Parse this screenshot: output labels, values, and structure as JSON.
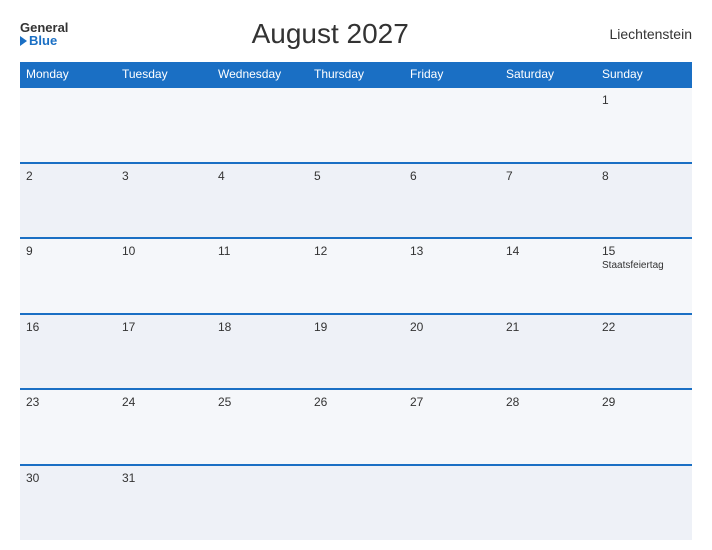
{
  "header": {
    "logo_general": "General",
    "logo_blue": "Blue",
    "title": "August 2027",
    "country": "Liechtenstein"
  },
  "weekdays": [
    "Monday",
    "Tuesday",
    "Wednesday",
    "Thursday",
    "Friday",
    "Saturday",
    "Sunday"
  ],
  "weeks": [
    [
      {
        "day": "",
        "event": ""
      },
      {
        "day": "",
        "event": ""
      },
      {
        "day": "",
        "event": ""
      },
      {
        "day": "",
        "event": ""
      },
      {
        "day": "",
        "event": ""
      },
      {
        "day": "",
        "event": ""
      },
      {
        "day": "1",
        "event": ""
      }
    ],
    [
      {
        "day": "2",
        "event": ""
      },
      {
        "day": "3",
        "event": ""
      },
      {
        "day": "4",
        "event": ""
      },
      {
        "day": "5",
        "event": ""
      },
      {
        "day": "6",
        "event": ""
      },
      {
        "day": "7",
        "event": ""
      },
      {
        "day": "8",
        "event": ""
      }
    ],
    [
      {
        "day": "9",
        "event": ""
      },
      {
        "day": "10",
        "event": ""
      },
      {
        "day": "11",
        "event": ""
      },
      {
        "day": "12",
        "event": ""
      },
      {
        "day": "13",
        "event": ""
      },
      {
        "day": "14",
        "event": ""
      },
      {
        "day": "15",
        "event": "Staatsfeiertag"
      }
    ],
    [
      {
        "day": "16",
        "event": ""
      },
      {
        "day": "17",
        "event": ""
      },
      {
        "day": "18",
        "event": ""
      },
      {
        "day": "19",
        "event": ""
      },
      {
        "day": "20",
        "event": ""
      },
      {
        "day": "21",
        "event": ""
      },
      {
        "day": "22",
        "event": ""
      }
    ],
    [
      {
        "day": "23",
        "event": ""
      },
      {
        "day": "24",
        "event": ""
      },
      {
        "day": "25",
        "event": ""
      },
      {
        "day": "26",
        "event": ""
      },
      {
        "day": "27",
        "event": ""
      },
      {
        "day": "28",
        "event": ""
      },
      {
        "day": "29",
        "event": ""
      }
    ],
    [
      {
        "day": "30",
        "event": ""
      },
      {
        "day": "31",
        "event": ""
      },
      {
        "day": "",
        "event": ""
      },
      {
        "day": "",
        "event": ""
      },
      {
        "day": "",
        "event": ""
      },
      {
        "day": "",
        "event": ""
      },
      {
        "day": "",
        "event": ""
      }
    ]
  ],
  "colors": {
    "header_bg": "#1a6fc4",
    "header_text": "#ffffff",
    "row_odd": "#f5f7fa",
    "row_even": "#eef1f7",
    "border": "#1a6fc4"
  }
}
